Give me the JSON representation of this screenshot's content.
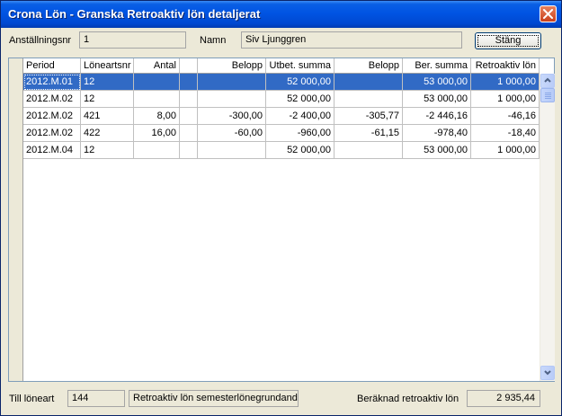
{
  "window": {
    "title": "Crona Lön - Granska Retroaktiv lön detaljerat"
  },
  "header": {
    "employee_no_label": "Anställningsnr",
    "employee_no_value": "1",
    "name_label": "Namn",
    "name_value": "Siv Ljunggren",
    "close_button_label": "Stäng"
  },
  "grid": {
    "columns": [
      "Period",
      "Löneartsnr",
      "Antal",
      "",
      "Belopp",
      "Utbet. summa",
      "Belopp",
      "Ber. summa",
      "Retroaktiv lön"
    ],
    "rows": [
      [
        "2012.M.01",
        "12",
        "",
        "",
        "",
        "52 000,00",
        "",
        "53 000,00",
        "1 000,00"
      ],
      [
        "2012.M.02",
        "12",
        "",
        "",
        "",
        "52 000,00",
        "",
        "53 000,00",
        "1 000,00"
      ],
      [
        "2012.M.02",
        "421",
        "8,00",
        "",
        "-300,00",
        "-2 400,00",
        "-305,77",
        "-2 446,16",
        "-46,16"
      ],
      [
        "2012.M.02",
        "422",
        "16,00",
        "",
        "-60,00",
        "-960,00",
        "-61,15",
        "-978,40",
        "-18,40"
      ],
      [
        "2012.M.04",
        "12",
        "",
        "",
        "",
        "52 000,00",
        "",
        "53 000,00",
        "1 000,00"
      ]
    ],
    "selected_row": 0
  },
  "footer": {
    "to_wage_type_label": "Till löneart",
    "to_wage_type_value": "144",
    "to_wage_type_desc": "Retroaktiv lön semesterlönegrundande",
    "calc_retro_label": "Beräknad retroaktiv lön",
    "calc_retro_value": "2 935,44"
  },
  "icons": {
    "close": "close-x-icon",
    "scroll_up": "arrow-up-icon",
    "scroll_down": "arrow-down-icon"
  },
  "colors": {
    "title_bar": "#0054E3",
    "selection": "#316AC5",
    "window_bg": "#ECE9D8",
    "close_button": "#D9532C"
  }
}
